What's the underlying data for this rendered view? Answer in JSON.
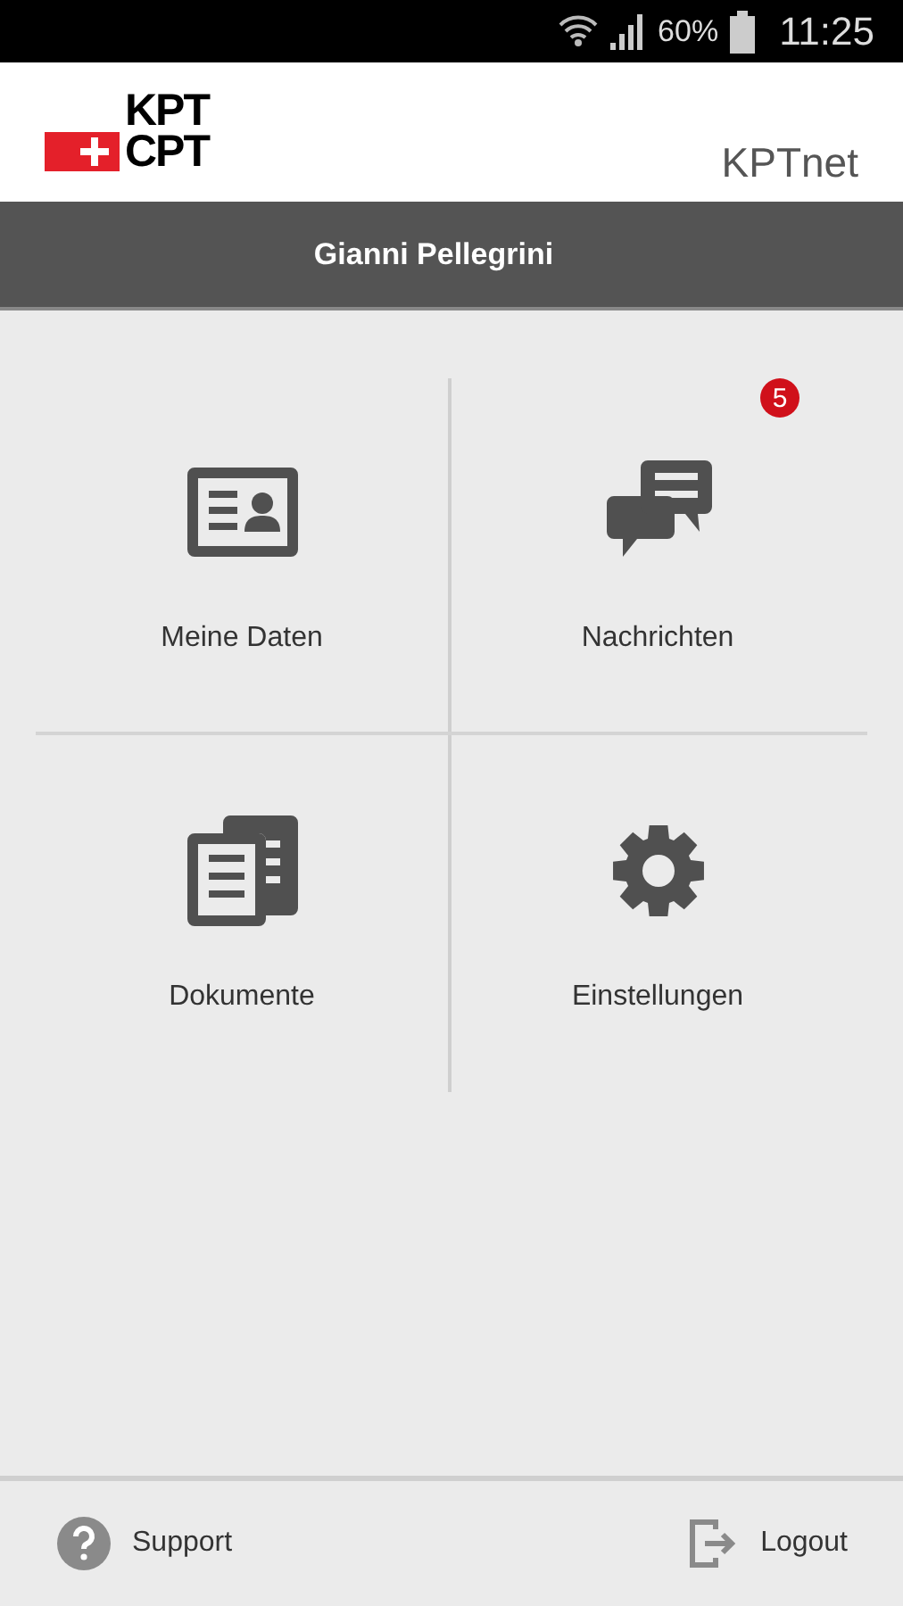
{
  "status_bar": {
    "battery": "60%",
    "time": "11:25"
  },
  "header": {
    "logo_top": "KPT",
    "logo_bottom": "CPT",
    "app_name": "KPTnet"
  },
  "user_bar": {
    "name": "Gianni Pellegrini"
  },
  "tiles": [
    {
      "kind": "id-card",
      "label": "Meine Daten"
    },
    {
      "kind": "chat",
      "label": "Nachrichten"
    },
    {
      "kind": "documents",
      "label": "Dokumente"
    },
    {
      "kind": "gear",
      "label": "Einstellungen"
    }
  ],
  "message_badge": "5",
  "footer": [
    {
      "kind": "help",
      "label": "Support"
    },
    {
      "kind": "logout",
      "label": "Logout"
    }
  ]
}
